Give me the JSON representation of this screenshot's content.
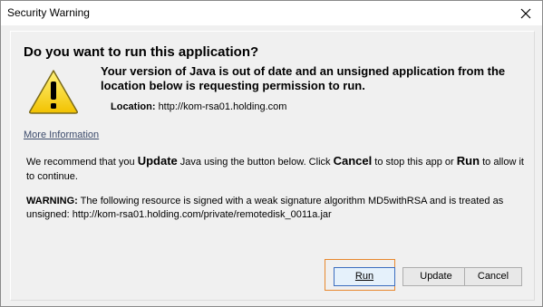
{
  "window": {
    "title": "Security Warning"
  },
  "dialog": {
    "heading": "Do you want to run this application?",
    "summary": "Your version of Java is out of date and an unsigned application from the location below is requesting permission to run.",
    "location_label": "Location:",
    "location_value": "http://kom-rsa01.holding.com",
    "more_info_link": "More Information",
    "recommend": {
      "part1": "We recommend that you ",
      "update_word": "Update",
      "part2": " Java using the button below. Click ",
      "cancel_word": "Cancel",
      "part3": " to stop this app or ",
      "run_word": "Run",
      "part4": " to allow it to continue."
    },
    "warning_label": "WARNING:",
    "warning_text": " The following resource is signed with a weak signature algorithm MD5withRSA and is treated as unsigned: http://kom-rsa01.holding.com/private/remotedisk_0011a.jar"
  },
  "buttons": {
    "run": "Run",
    "update": "Update",
    "cancel": "Cancel"
  },
  "colors": {
    "focus_outline": "#e8882e",
    "warning_icon_fill": "#f5d400",
    "link": "#3b4a6b"
  },
  "icons": {
    "close": "close-icon",
    "warning": "warning-triangle-icon"
  }
}
